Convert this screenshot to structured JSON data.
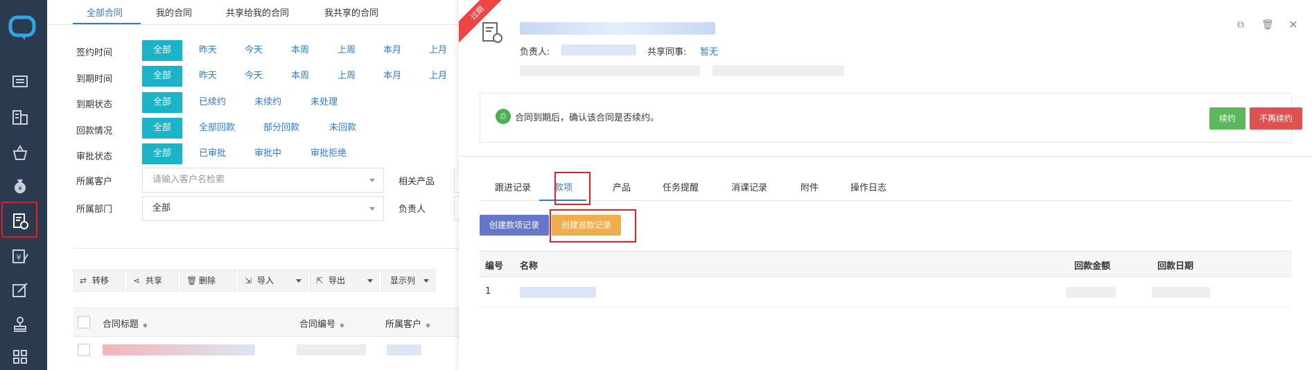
{
  "list": {
    "tabs": [
      {
        "label": "全部合同"
      },
      {
        "label": "我的合同"
      },
      {
        "label": "共享给我的合同"
      },
      {
        "label": "我共享的合同"
      }
    ],
    "filters": [
      {
        "label": "签约时间",
        "options": [
          "全部",
          "昨天",
          "今天",
          "本周",
          "上周",
          "本月",
          "上月"
        ]
      },
      {
        "label": "到期时间",
        "options": [
          "全部",
          "昨天",
          "今天",
          "本周",
          "上周",
          "本月",
          "上月"
        ]
      },
      {
        "label": "到期状态",
        "options": [
          "全部",
          "已续约",
          "未续约",
          "未处理"
        ]
      },
      {
        "label": "回款情况",
        "options": [
          "全部",
          "全部回款",
          "部分回款",
          "未回款"
        ]
      },
      {
        "label": "审批状态",
        "options": [
          "全部",
          "已审批",
          "审批中",
          "审批拒绝"
        ]
      }
    ],
    "customer_label": "所属客户",
    "customer_placeholder": "请输入客户名检索",
    "product_label": "相关产品",
    "dept_label": "所属部门",
    "dept_value": "全部",
    "owner_label": "负责人",
    "toolbar": {
      "transfer": "转移",
      "share": "共享",
      "delete": "删除",
      "import": "导入",
      "export": "导出",
      "columns": "显示列"
    },
    "columns": {
      "title": "合同标题",
      "number": "合同编号",
      "customer": "所属客户"
    }
  },
  "detail": {
    "ribbon": "过期",
    "owner_label": "负责人:",
    "shared_label": "共享同事:",
    "shared_value": "暂无",
    "notice_text": "合同到期后，确认该合同是否续约。",
    "renew_button": "续约",
    "no_renew_button": "不再续约",
    "tabs": [
      {
        "label": "跟进记录"
      },
      {
        "label": "款项"
      },
      {
        "label": "产品"
      },
      {
        "label": "任务提醒"
      },
      {
        "label": "消课记录"
      },
      {
        "label": "附件"
      },
      {
        "label": "操作日志"
      }
    ],
    "create_payment_button": "创建款项记录",
    "create_refund_button": "创建退款记录",
    "payment_columns": {
      "no": "编号",
      "name": "名称",
      "amount": "回款金额",
      "date": "回款日期"
    },
    "payment_rows": [
      {
        "no": "1"
      }
    ]
  },
  "colors": {
    "sidebar": "#2b3a4f",
    "accent": "#2b7bd3",
    "chip_active": "#1ab3c8",
    "highlight": "#e02020"
  }
}
